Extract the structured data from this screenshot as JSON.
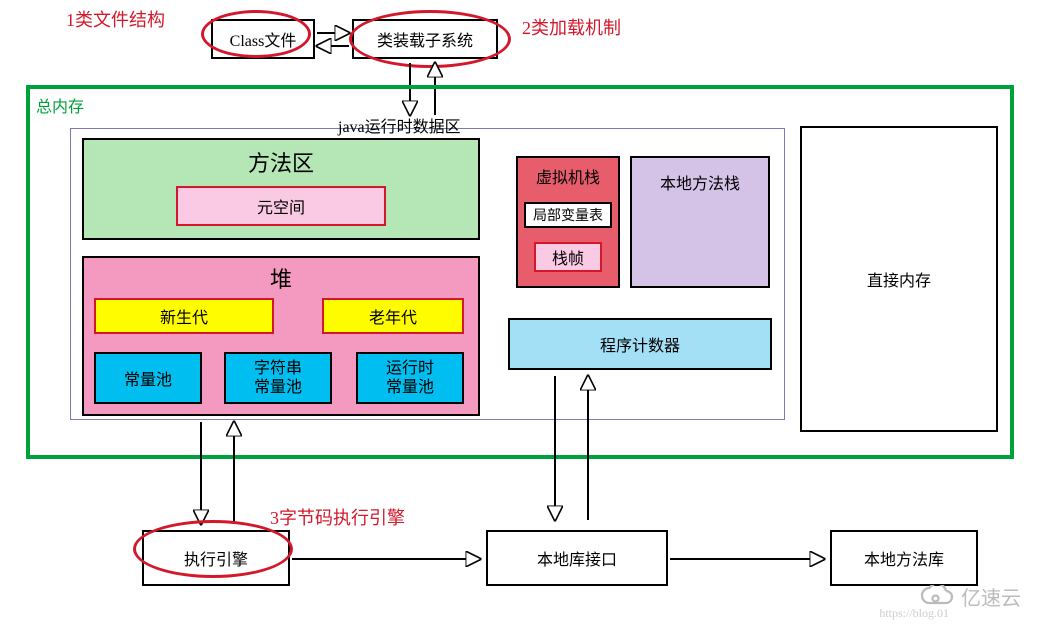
{
  "annotations": {
    "a1": "1类文件结构",
    "a2": "2类加载机制",
    "a3": "3字节码执行引擎"
  },
  "top": {
    "classFile": "Class文件",
    "loader": "类装载子系统"
  },
  "memory": {
    "total": "总内存",
    "runtime": "java运行时数据区",
    "methodArea": "方法区",
    "metaspace": "元空间",
    "heap": "堆",
    "newGen": "新生代",
    "oldGen": "老年代",
    "constPool": "常量池",
    "strPool1": "字符串",
    "strPool2": "常量池",
    "rtPool1": "运行时",
    "rtPool2": "常量池",
    "vmStack": "虚拟机栈",
    "localVarTable": "局部变量表",
    "stackFrame": "栈帧",
    "nativeStack": "本地方法栈",
    "pc": "程序计数器",
    "direct": "直接内存"
  },
  "bottom": {
    "execEngine": "执行引擎",
    "nativeInterface": "本地库接口",
    "nativeLib": "本地方法库"
  },
  "watermark": "亿速云",
  "footer": "https://blog.01"
}
